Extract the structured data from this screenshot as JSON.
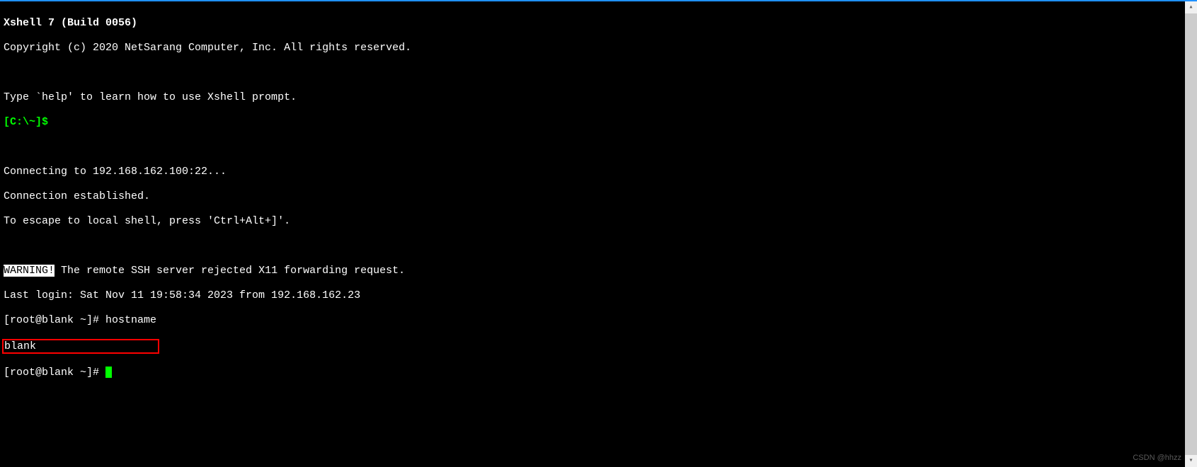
{
  "header": {
    "title": "Xshell 7 (Build 0056)",
    "copyright": "Copyright (c) 2020 NetSarang Computer, Inc. All rights reserved."
  },
  "help_line": "Type `help' to learn how to use Xshell prompt.",
  "local_prompt": "[C:\\~]$ ",
  "connection": {
    "connecting": "Connecting to 192.168.162.100:22...",
    "established": "Connection established.",
    "escape": "To escape to local shell, press 'Ctrl+Alt+]'."
  },
  "warning": {
    "label": "WARNING!",
    "message": " The remote SSH server rejected X11 forwarding request."
  },
  "last_login": "Last login: Sat Nov 11 19:58:34 2023 from 192.168.162.23",
  "session": {
    "prompt1": "[root@blank ~]# ",
    "command1": "hostname",
    "output1": "blank",
    "prompt2": "[root@blank ~]# "
  },
  "watermark": "CSDN @hhzz"
}
